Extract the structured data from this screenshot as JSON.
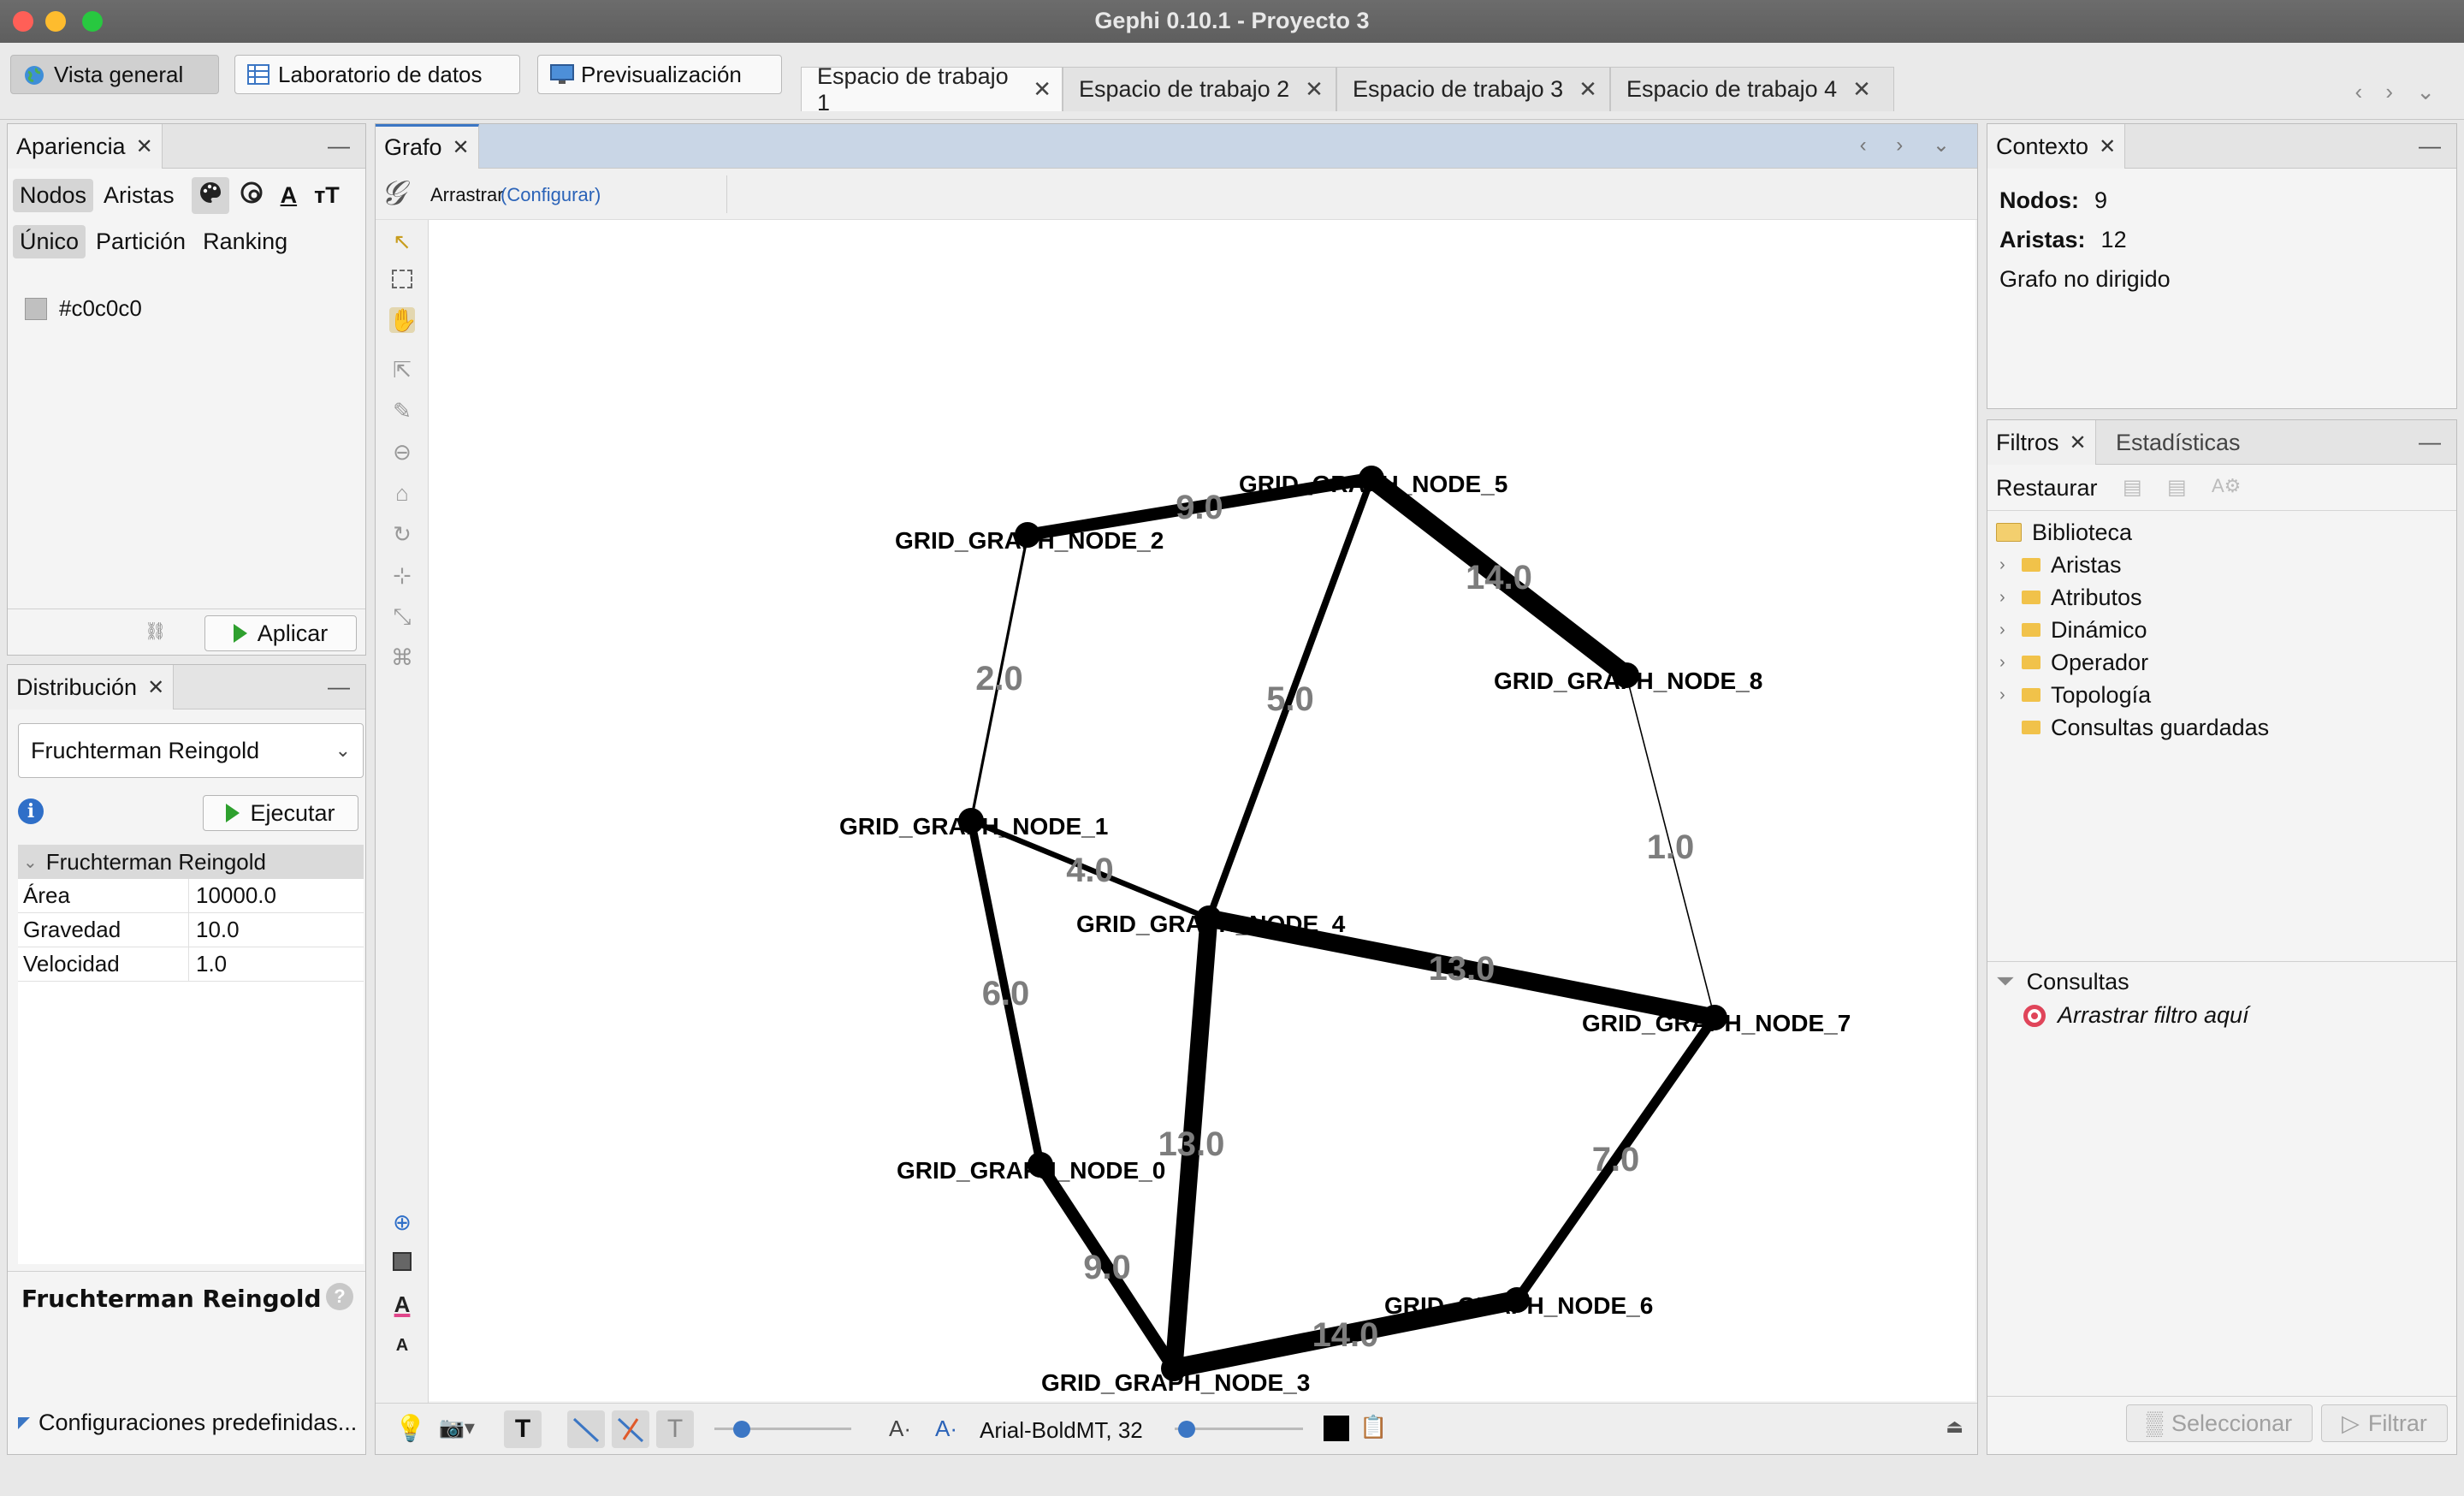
{
  "window": {
    "title": "Gephi 0.10.1 - Proyecto 3"
  },
  "modes": {
    "overview": "Vista general",
    "data_lab": "Laboratorio de datos",
    "preview": "Previsualización"
  },
  "workspaces": [
    "Espacio de trabajo 1",
    "Espacio de trabajo 2",
    "Espacio de trabajo 3",
    "Espacio de trabajo 4"
  ],
  "appearance": {
    "tab": "Apariencia",
    "nodes": "Nodos",
    "edges": "Aristas",
    "unique": "Único",
    "partition": "Partición",
    "ranking": "Ranking",
    "color_value": "#c0c0c0",
    "apply": "Aplicar"
  },
  "layout": {
    "tab": "Distribución",
    "algorithm": "Fruchterman Reingold",
    "run": "Ejecutar",
    "section": "Fruchterman Reingold",
    "props": [
      {
        "k": "Área",
        "v": "10000.0"
      },
      {
        "k": "Gravedad",
        "v": "10.0"
      },
      {
        "k": "Velocidad",
        "v": "1.0"
      }
    ],
    "desc_title": "Fruchterman Reingold",
    "presets": "Configuraciones predefinidas..."
  },
  "graph": {
    "tab": "Grafo",
    "drag": "Arrastrar",
    "configure": "(Configurar)",
    "font_label": "Arial-BoldMT, 32",
    "node_color": "#000000",
    "nodes": [
      {
        "id": "n0",
        "label": "GRID_GRAPH_NODE_0"
      },
      {
        "id": "n1",
        "label": "GRID_GRAPH_NODE_1"
      },
      {
        "id": "n2",
        "label": "GRID_GRAPH_NODE_2"
      },
      {
        "id": "n3",
        "label": "GRID_GRAPH_NODE_3"
      },
      {
        "id": "n4",
        "label": "GRID_GRAPH_NODE_4"
      },
      {
        "id": "n5",
        "label": "GRID_GRAPH_NODE_5"
      },
      {
        "id": "n6",
        "label": "GRID_GRAPH_NODE_6"
      },
      {
        "id": "n7",
        "label": "GRID_GRAPH_NODE_7"
      },
      {
        "id": "n8",
        "label": "GRID_GRAPH_NODE_8"
      }
    ],
    "edges": [
      {
        "from": "n2",
        "to": "n5",
        "weight": "9.0"
      },
      {
        "from": "n5",
        "to": "n8",
        "weight": "14.0"
      },
      {
        "from": "n2",
        "to": "n1",
        "weight": "2.0"
      },
      {
        "from": "n5",
        "to": "n4",
        "weight": "5.0"
      },
      {
        "from": "n8",
        "to": "n7",
        "weight": "1.0"
      },
      {
        "from": "n1",
        "to": "n4",
        "weight": "4.0"
      },
      {
        "from": "n4",
        "to": "n7",
        "weight": "13.0"
      },
      {
        "from": "n1",
        "to": "n0",
        "weight": "6.0"
      },
      {
        "from": "n4",
        "to": "n3",
        "weight": "13.0"
      },
      {
        "from": "n7",
        "to": "n6",
        "weight": "7.0"
      },
      {
        "from": "n0",
        "to": "n3",
        "weight": "9.0"
      },
      {
        "from": "n3",
        "to": "n6",
        "weight": "14.0"
      }
    ]
  },
  "context": {
    "tab": "Contexto",
    "nodes_label": "Nodos:",
    "nodes_value": "9",
    "edges_label": "Aristas:",
    "edges_value": "12",
    "type": "Grafo no dirigido"
  },
  "filters": {
    "tab": "Filtros",
    "stats_tab": "Estadísticas",
    "reset": "Restaurar",
    "library": "Biblioteca",
    "items": [
      "Aristas",
      "Atributos",
      "Dinámico",
      "Operador",
      "Topología"
    ],
    "saved": "Consultas guardadas",
    "queries": "Consultas",
    "drop_hint": "Arrastrar filtro aquí",
    "select": "Seleccionar",
    "filter": "Filtrar"
  }
}
